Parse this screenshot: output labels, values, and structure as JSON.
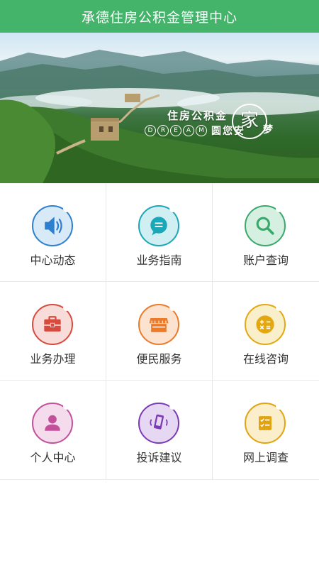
{
  "header": {
    "title": "承德住房公积金管理中心"
  },
  "banner": {
    "slogan_line1": "住房公积金",
    "dream_letters": [
      "D",
      "R",
      "E",
      "A",
      "M"
    ],
    "slogan_line2": "圆您安",
    "big_char": "家",
    "tail_char": "梦"
  },
  "menu": [
    {
      "label": "中心动态",
      "icon": "speaker-icon",
      "color": "#2f7fcf",
      "bg": "#d8e9f8"
    },
    {
      "label": "业务指南",
      "icon": "chat-bubble-icon",
      "color": "#1aa7b8",
      "bg": "#cfeff3"
    },
    {
      "label": "账户查询",
      "icon": "magnifier-icon",
      "color": "#3aa86b",
      "bg": "#d5f0e1"
    },
    {
      "label": "业务办理",
      "icon": "briefcase-icon",
      "color": "#d64b3d",
      "bg": "#f7dcd9"
    },
    {
      "label": "便民服务",
      "icon": "storefront-icon",
      "color": "#ec7a2b",
      "bg": "#fce3d0"
    },
    {
      "label": "在线咨询",
      "icon": "calculator-icon",
      "color": "#e3a712",
      "bg": "#faefcb"
    },
    {
      "label": "个人中心",
      "icon": "person-icon",
      "color": "#c3509a",
      "bg": "#f4dcec"
    },
    {
      "label": "投诉建议",
      "icon": "phone-vibrate-icon",
      "color": "#7b3ab6",
      "bg": "#e6d8f3"
    },
    {
      "label": "网上调查",
      "icon": "checklist-icon",
      "color": "#e2a310",
      "bg": "#faeecb"
    }
  ]
}
